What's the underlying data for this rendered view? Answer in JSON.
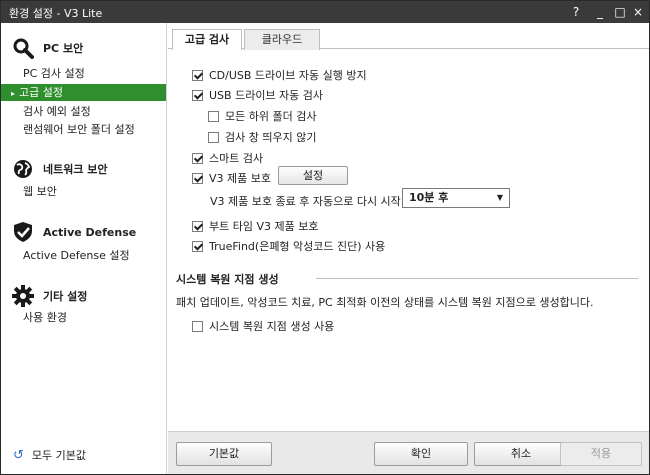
{
  "window": {
    "title": "환경 설정 - V3 Lite",
    "help_icon": "?",
    "minimize_icon": "_",
    "maximize_icon": "□",
    "close_icon": "×"
  },
  "sidebar": {
    "sections": [
      {
        "icon": "search-icon",
        "title": "PC 보안",
        "items": [
          "PC 검사 설정",
          "고급 설정",
          "검사 예외 설정",
          "랜섬웨어 보안 폴더 설정"
        ]
      },
      {
        "icon": "globe-icon",
        "title": "네트워크 보안",
        "items": [
          "웹 보안"
        ]
      },
      {
        "icon": "shield-check-icon",
        "title": "Active Defense",
        "items": [
          "Active Defense 설정"
        ]
      },
      {
        "icon": "gear-icon",
        "title": "기타 설정",
        "items": [
          "사용 환경"
        ]
      }
    ],
    "active_item": "고급 설정",
    "reset_all": "모두 기본값",
    "accent": "#2f8f2f"
  },
  "tabs": [
    "고급 검사",
    "클라우드"
  ],
  "options": {
    "usb_autorun_block": {
      "label": "CD/USB 드라이브 자동 실행 방지",
      "checked": true
    },
    "usb_auto_scan": {
      "label": "USB 드라이브 자동 검사",
      "checked": true
    },
    "all_subfolders": {
      "label": "모든 하위 폴더 검사",
      "checked": false
    },
    "no_scan_popup": {
      "label": "검사 창 띄우지 않기",
      "checked": false
    },
    "smart_scan": {
      "label": "스마트 검사",
      "checked": true
    },
    "v3_protect": {
      "label": "V3 제품 보호",
      "checked": true
    },
    "v3_protect_settings_button": "설정",
    "restart_label": "V3 제품 보호 종료 후 자동으로 다시 시작",
    "restart_value": "10분 후",
    "boot_time_protect": {
      "label": "부트 타임 V3 제품 보호",
      "checked": true
    },
    "truefind": {
      "label": "TrueFind(은폐형 악성코드 진단) 사용",
      "checked": true
    }
  },
  "restore": {
    "title": "시스템 복원 지점 생성",
    "description": "패치 업데이트, 악성코드 치료, PC 최적화 이전의 상태를 시스템 복원 지점으로 생성합니다.",
    "enable": {
      "label": "시스템 복원 지점 생성 사용",
      "checked": false
    }
  },
  "footer": {
    "default_button": "기본값",
    "ok_button": "확인",
    "cancel_button": "취소",
    "apply_button": "적용"
  }
}
